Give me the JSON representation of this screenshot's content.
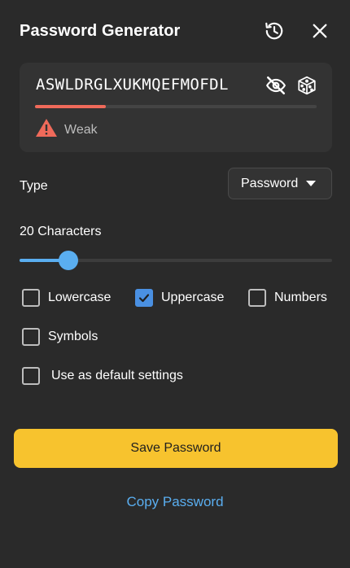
{
  "header": {
    "title": "Password Generator",
    "history_icon": "history-icon",
    "close_icon": "close-icon"
  },
  "password": {
    "value": "ASWLDRGLXUKMQEFMOFDL",
    "visibility_icon": "eye-off-icon",
    "regenerate_icon": "dice-icon",
    "strength": {
      "label": "Weak",
      "fraction": 0.25,
      "color": "#f06a5a",
      "icon": "warning-icon"
    }
  },
  "type": {
    "label": "Type",
    "selected": "Password",
    "dropdown_icon": "caret-down-icon"
  },
  "length": {
    "label": "20 Characters",
    "value": 20,
    "slider_fraction": 0.155
  },
  "options": {
    "lowercase": {
      "label": "Lowercase",
      "checked": false
    },
    "uppercase": {
      "label": "Uppercase",
      "checked": true
    },
    "numbers": {
      "label": "Numbers",
      "checked": false
    },
    "symbols": {
      "label": "Symbols",
      "checked": false
    },
    "default_settings": {
      "label": "Use as default settings",
      "checked": false
    }
  },
  "actions": {
    "save_label": "Save Password",
    "copy_label": "Copy Password"
  },
  "colors": {
    "background": "#2a2a2a",
    "card": "#333333",
    "accent_blue": "#5aaef0",
    "accent_yellow": "#f7c32e",
    "weak_red": "#f06a5a"
  }
}
